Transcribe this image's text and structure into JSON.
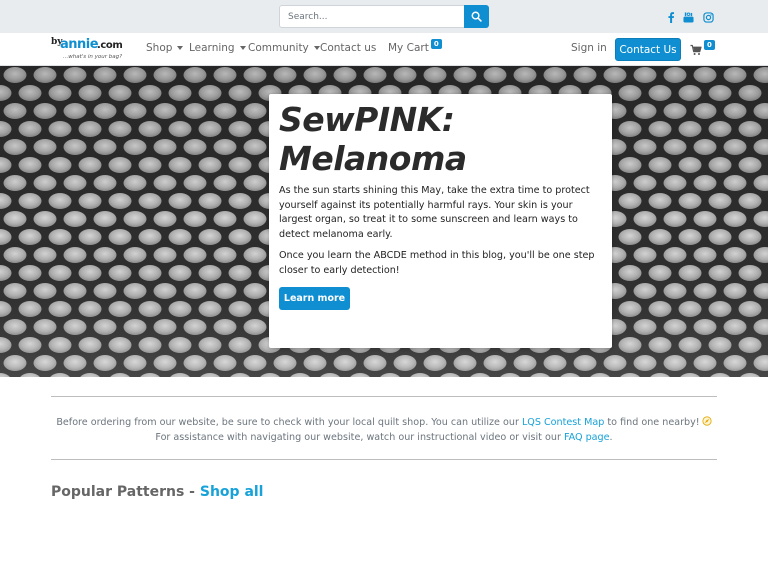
{
  "topbar": {
    "search_placeholder": "Search...",
    "social_icons": [
      "facebook-icon",
      "youtube-icon",
      "instagram-icon"
    ]
  },
  "nav": {
    "logo": {
      "by": "by",
      "brand": "annie",
      "tld": ".com",
      "tagline": "...what's in your bag?"
    },
    "items": [
      {
        "label": "Shop",
        "dropdown": true
      },
      {
        "label": "Learning",
        "dropdown": true
      },
      {
        "label": "Community",
        "dropdown": true
      },
      {
        "label": "Contact us",
        "dropdown": false
      }
    ],
    "cart_label": "My Cart",
    "cart_count": "0",
    "sign_in": "Sign in",
    "contact_button": "Contact Us",
    "cart_icon_count": "0"
  },
  "hero": {
    "title_line1": "SewPINK:",
    "title_line2": "Melanoma",
    "paragraph1": "As the sun starts shining this May, take the extra time to protect yourself against its potentially harmful rays. Your skin is your largest organ, so treat it to some sunscreen and learn ways to detect melanoma early.",
    "paragraph2": "Once you learn the ABCDE method in this blog, you'll be one step closer to early detection!",
    "button": "Learn more"
  },
  "notice": {
    "line1_before": "Before ordering from our website, be sure to check with your local quilt shop. You can utilize our ",
    "line1_link": "LQS Contest Map",
    "line1_after": " to find one nearby!",
    "line2_before": "For assistance with navigating our website, watch our instructional video or visit our ",
    "line2_link": "FAQ page",
    "line2_after": "."
  },
  "popular": {
    "title": "Popular Patterns",
    "separator": " - ",
    "link": "Shop all"
  },
  "colors": {
    "accent": "#0f8fd1",
    "link": "#17a2d8",
    "topbar_bg": "#e9ecef"
  }
}
